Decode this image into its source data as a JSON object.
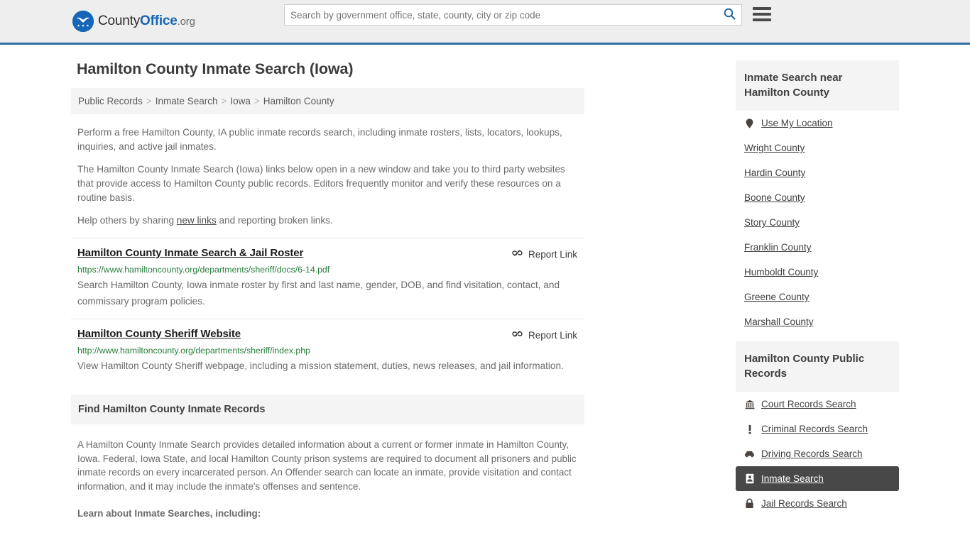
{
  "header": {
    "brand": {
      "part1": "County",
      "part2": "Office",
      "part3": ".org",
      "emblem_icon": "eagle-shield-icon"
    },
    "search": {
      "placeholder": "Search by government office, state, county, city or zip code",
      "value": "",
      "button_icon": "search-icon"
    },
    "menu_icon": "hamburger-menu-icon",
    "accent_color": "#2e6da4",
    "background_color": "#eeeeee"
  },
  "main": {
    "title": "Hamilton County Inmate Search (Iowa)",
    "breadcrumb": [
      {
        "label": "Public Records"
      },
      {
        "label": "Inmate Search"
      },
      {
        "label": "Iowa"
      },
      {
        "label": "Hamilton County"
      }
    ],
    "breadcrumb_separator": ">",
    "intro": {
      "p1": "Perform a free Hamilton County, IA public inmate records search, including inmate rosters, lists, locators, lookups, inquiries, and active jail inmates.",
      "p2": "The Hamilton County Inmate Search (Iowa) links below open in a new window and take you to third party websites that provide access to Hamilton County public records. Editors frequently monitor and verify these resources on a routine basis.",
      "p3_before": "Help others by sharing ",
      "p3_link": "new links",
      "p3_after": " and reporting broken links."
    },
    "report_link_label": "Report Link",
    "report_link_icon": "broken-link-icon",
    "results": [
      {
        "title": "Hamilton County Inmate Search & Jail Roster",
        "url": "https://www.hamiltoncounty.org/departments/sheriff/docs/6-14.pdf",
        "description": "Search Hamilton County, Iowa inmate roster by first and last name, gender, DOB, and find visitation, contact, and commissary program policies."
      },
      {
        "title": "Hamilton County Sheriff Website",
        "url": "http://www.hamiltoncounty.org/departments/sheriff/index.php",
        "description": "View Hamilton County Sheriff webpage, including a mission statement, duties, news releases, and jail information."
      }
    ],
    "section": {
      "heading": "Find Hamilton County Inmate Records",
      "body": "A Hamilton County Inmate Search provides detailed information about a current or former inmate in Hamilton County, Iowa. Federal, Iowa State, and local Hamilton County prison systems are required to document all prisoners and public inmate records on every incarcerated person. An Offender search can locate an inmate, provide visitation and contact information, and it may include the inmate's offenses and sentence.",
      "learn_heading": "Learn about Inmate Searches, including:"
    }
  },
  "sidebar": {
    "near": {
      "heading": "Inmate Search near Hamilton County",
      "use_my_location": {
        "label": "Use My Location",
        "icon": "map-pin-icon"
      },
      "counties": [
        {
          "label": "Wright County"
        },
        {
          "label": "Hardin County"
        },
        {
          "label": "Boone County"
        },
        {
          "label": "Story County"
        },
        {
          "label": "Franklin County"
        },
        {
          "label": "Humboldt County"
        },
        {
          "label": "Greene County"
        },
        {
          "label": "Marshall County"
        }
      ]
    },
    "public_records": {
      "heading": "Hamilton County Public Records",
      "highlight_color": "#484848",
      "items": [
        {
          "label": "Court Records Search",
          "icon": "courthouse-icon",
          "active": false
        },
        {
          "label": "Criminal Records Search",
          "icon": "exclamation-icon",
          "active": false
        },
        {
          "label": "Driving Records Search",
          "icon": "car-icon",
          "active": false
        },
        {
          "label": "Inmate Search",
          "icon": "id-badge-icon",
          "active": true
        },
        {
          "label": "Jail Records Search",
          "icon": "lock-icon",
          "active": false
        }
      ]
    }
  }
}
